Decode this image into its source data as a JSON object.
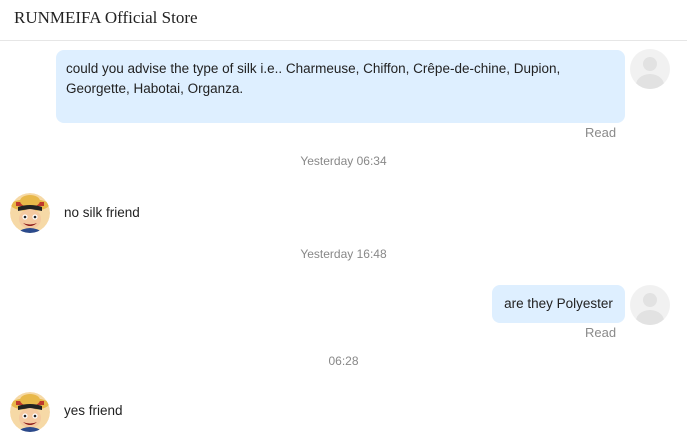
{
  "header": {
    "title": "RUNMEIFA Official Store"
  },
  "messages": [
    {
      "side": "out",
      "text": "could you advise the type of silk i.e.. Charmeuse, Chiffon, Crêpe-de-chine, Dupion, Georgette, Habotai, Organza.",
      "status": "Read"
    },
    {
      "side": "time",
      "text": "Yesterday 06:34"
    },
    {
      "side": "in",
      "text": "no silk friend"
    },
    {
      "side": "time",
      "text": "Yesterday 16:48"
    },
    {
      "side": "out",
      "text": "are they Polyester",
      "status": "Read"
    },
    {
      "side": "time",
      "text": "06:28"
    },
    {
      "side": "in",
      "text": "yes friend"
    }
  ],
  "icons": {
    "user_avatar": "user-placeholder-icon",
    "store_avatar": "store-avatar-cartoon"
  },
  "colors": {
    "outgoing_bubble": "#deefff",
    "timestamp": "#888888",
    "read_status": "#8a8a8a"
  }
}
